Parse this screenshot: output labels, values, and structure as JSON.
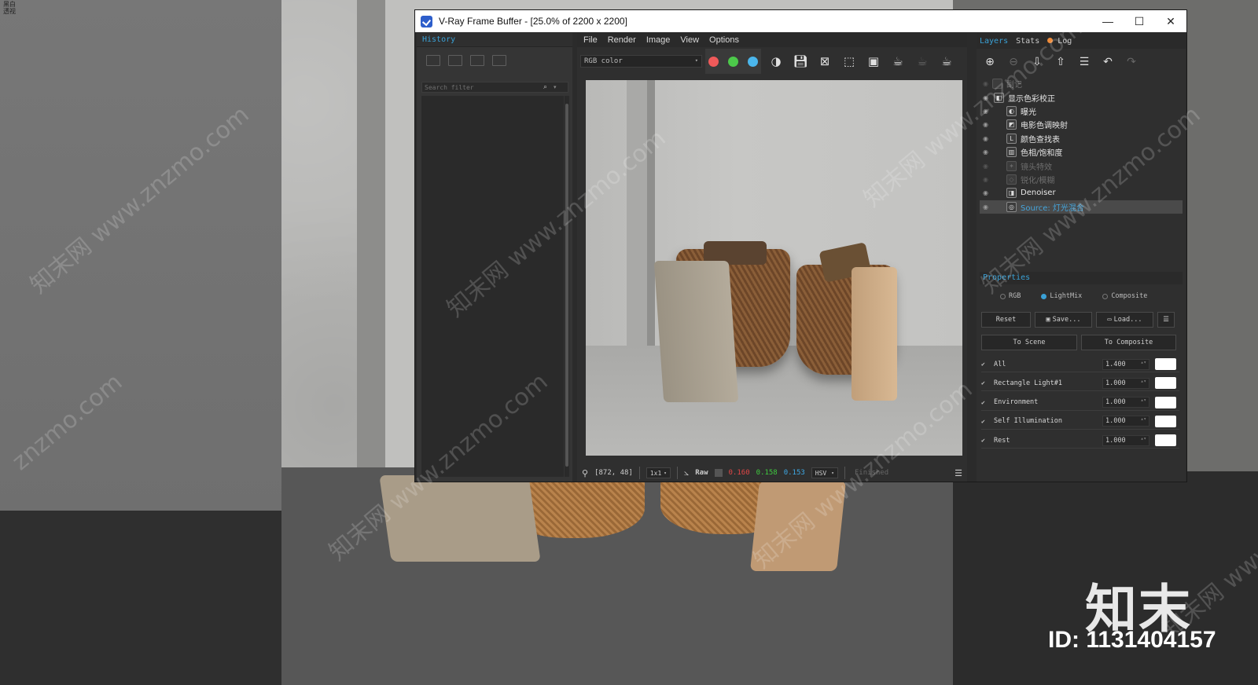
{
  "corner_label": [
    "黑白",
    "透视"
  ],
  "watermarks": [
    "知末网 www.znzmo.com",
    "知末网 www.znzmo.com",
    "znzmo.com",
    "知末网 www.znzmo.com",
    "知末网 www.znzmo.com",
    "知末网 www.znzmo.com",
    "知末网 www.znzmo.com",
    "知末网 www.znzmo.com"
  ],
  "brand": {
    "logo": "知末",
    "id": "ID: 1131404157"
  },
  "window": {
    "title": "V-Ray Frame Buffer - [25.0% of 2200 x 2200]",
    "controls": {
      "minimize": "—",
      "maximize": "☐",
      "close": "✕"
    }
  },
  "history": {
    "header": "History",
    "search_placeholder": "Search filter"
  },
  "center": {
    "menu": [
      "File",
      "Render",
      "Image",
      "View",
      "Options"
    ],
    "channel": "RGB color",
    "channel_dots": [
      "#ef5a5a",
      "#4cc94a",
      "#4bb6ec"
    ],
    "status": {
      "coords": "[872, 48]",
      "zoom": "1x1",
      "mode": "Raw",
      "r": "0.160",
      "g": "0.158",
      "b": "0.153",
      "colorspace": "HSV",
      "state": "Finished"
    },
    "colors": {
      "r": "#e04646",
      "g": "#3fcb3f",
      "b": "#3ea8e4"
    }
  },
  "right": {
    "tabs": [
      "Layers",
      "Stats",
      "Log"
    ],
    "layers": [
      {
        "label": "显示色彩校正",
        "icon": "◧",
        "indent": 0,
        "dim": false,
        "selected": false,
        "visible": true
      },
      {
        "label": "曝光",
        "icon": "◐",
        "indent": 1,
        "dim": false,
        "selected": false,
        "visible": true
      },
      {
        "label": "电影色调映射",
        "icon": "◩",
        "indent": 1,
        "dim": false,
        "selected": false,
        "visible": true
      },
      {
        "label": "颜色查找表",
        "icon": "L",
        "indent": 1,
        "dim": false,
        "selected": false,
        "visible": true
      },
      {
        "label": "色相/饱和度",
        "icon": "▥",
        "indent": 1,
        "dim": false,
        "selected": false,
        "visible": true
      },
      {
        "label": "镜头特效",
        "icon": "✦",
        "indent": 1,
        "dim": true,
        "selected": false,
        "visible": false
      },
      {
        "label": "锐化/模糊",
        "icon": "◇",
        "indent": 1,
        "dim": true,
        "selected": false,
        "visible": false
      },
      {
        "label": "Denoiser",
        "icon": "◨",
        "indent": 1,
        "dim": false,
        "selected": false,
        "visible": true
      },
      {
        "label": "Source: 灯光混合",
        "icon": "◎",
        "indent": 1,
        "dim": false,
        "selected": true,
        "visible": true
      }
    ],
    "stamp_row": "副记",
    "properties_header": "Properties",
    "modes": [
      "RGB",
      "LightMix",
      "Composite"
    ],
    "buttons": {
      "reset": "Reset",
      "save": "Save...",
      "load": "Load...",
      "to_scene": "To Scene",
      "to_composite": "To Composite"
    },
    "lightmix": [
      {
        "name": "All",
        "value": "1.400"
      },
      {
        "name": "Rectangle Light#1",
        "value": "1.000"
      },
      {
        "name": "Environment",
        "value": "1.000"
      },
      {
        "name": "Self Illumination",
        "value": "1.000"
      },
      {
        "name": "Rest",
        "value": "1.000"
      }
    ]
  }
}
